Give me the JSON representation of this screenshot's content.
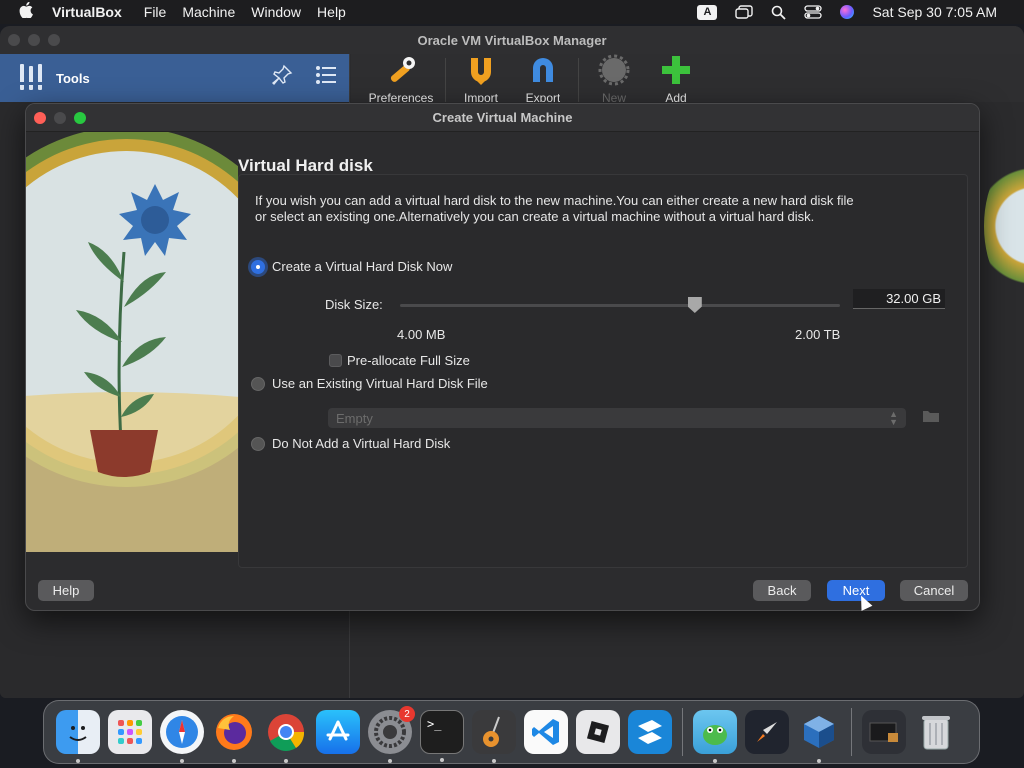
{
  "menubar": {
    "app_name": "VirtualBox",
    "menus": [
      "File",
      "Machine",
      "Window",
      "Help"
    ],
    "input_source": "A",
    "datetime": "Sat Sep 30  7:05 AM"
  },
  "manager": {
    "title": "Oracle VM VirtualBox Manager",
    "tools_label": "Tools",
    "toolbar": [
      "Preferences",
      "Import",
      "Export",
      "New",
      "Add"
    ]
  },
  "dialog": {
    "title": "Create Virtual Machine",
    "section_title": "Virtual Hard disk",
    "description": "If you wish you can add a virtual hard disk to the new machine.You can either create a new hard disk file or select an existing one.Alternatively you can create a virtual machine without a virtual hard disk.",
    "option_create": "Create a Virtual Hard Disk Now",
    "disk_size_label": "Disk Size:",
    "disk_size_value": "32.00 GB",
    "disk_size_fraction": 0.67,
    "range_min": "4.00 MB",
    "range_max": "2.00 TB",
    "preallocate_label": "Pre-allocate Full Size",
    "option_existing": "Use an Existing Virtual Hard Disk File",
    "existing_placeholder": "Empty",
    "option_none": "Do Not Add a Virtual Hard Disk",
    "buttons": {
      "help": "Help",
      "back": "Back",
      "next": "Next",
      "cancel": "Cancel"
    }
  },
  "dock": {
    "settings_badge": "2",
    "terminal_glyph": ">_"
  },
  "colors": {
    "accent": "#2f6fe0",
    "tools_bar": "#3a5f95",
    "close": "#ff5f57",
    "zoom": "#28c840"
  }
}
